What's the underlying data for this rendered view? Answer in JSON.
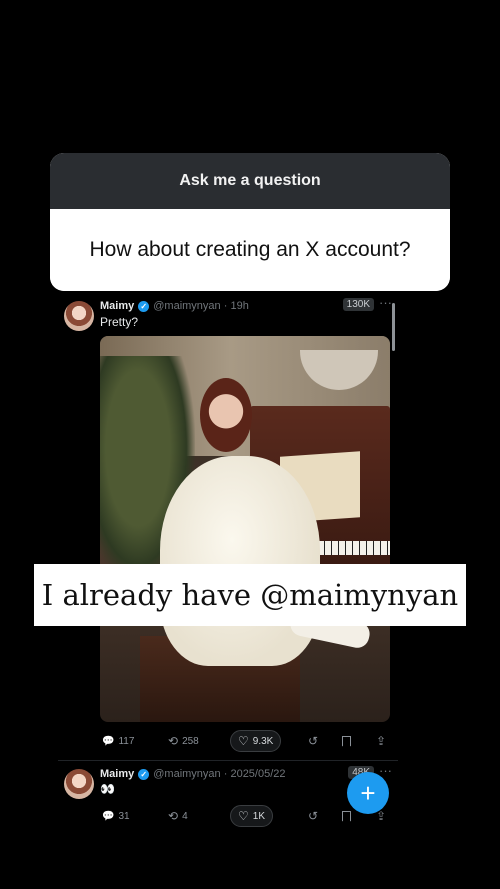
{
  "question_sticker": {
    "header": "Ask me a question",
    "question": "How about creating an X account?"
  },
  "tweets": [
    {
      "name": "Maimy",
      "handle": "@maimynyan",
      "time": "19h",
      "views": "130K",
      "text": "Pretty?",
      "replies": "117",
      "reposts": "258",
      "likes": "9.3K"
    },
    {
      "name": "Maimy",
      "handle": "@maimynyan",
      "time": "2025/05/22",
      "views": "48K",
      "text": "👀",
      "replies": "31",
      "reposts": "4",
      "likes": "1K"
    }
  ],
  "caption": "I already have @maimynyan",
  "icons": {
    "reply": "💬",
    "repost": "⟲",
    "like": "♡",
    "grok": "↺",
    "bookmark": "🔖",
    "share": "⇪",
    "more": "···",
    "verified": "✓",
    "compose": "+"
  },
  "colors": {
    "accent": "#1d9bf0",
    "background": "#000000",
    "sticker_header": "#2a2d31"
  }
}
